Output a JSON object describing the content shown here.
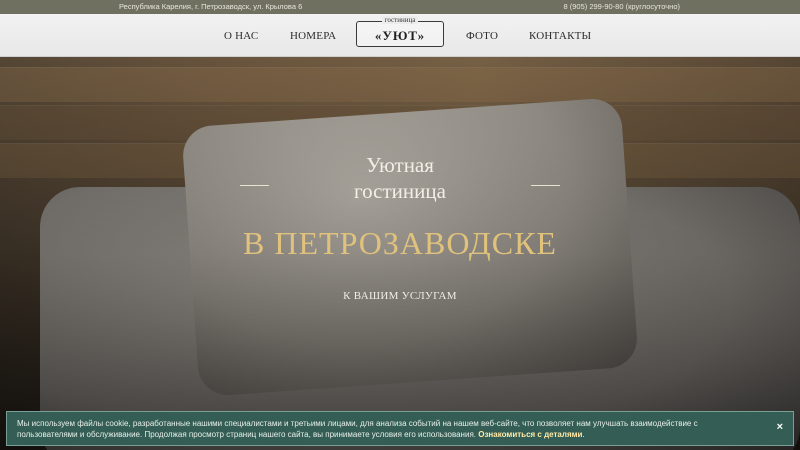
{
  "topbar": {
    "address": "Республика Карелия, г. Петрозаводск, ул. Крылова 6",
    "phone": "8 (905) 299-90-80 (круглосуточно)"
  },
  "nav": {
    "about": "О НАС",
    "rooms": "НОМЕРА",
    "photo": "ФОТО",
    "contacts": "КОНТАКТЫ"
  },
  "logo": {
    "small": "гостиница",
    "name": "«УЮТ»"
  },
  "hero": {
    "line1": "Уютная",
    "line2": "гостиница",
    "line3": "В ПЕТРОЗАВОДСКЕ",
    "line4": "К ВАШИМ УСЛУГАМ"
  },
  "cookie": {
    "text": "Мы используем файлы cookie, разработанные нашими специалистами и третьими лицами, для анализа событий на нашем веб-сайте, что позволяет нам улучшать взаимодействие с пользователями и обслуживание. Продолжая просмотр страниц нашего сайта, вы принимаете условия его использования.",
    "link": "Ознакомиться с деталями",
    "close": "×"
  },
  "colors": {
    "topbar": "#6f705f",
    "accent_gold": "#e0c27c",
    "cookie_bg": "#345e55"
  }
}
